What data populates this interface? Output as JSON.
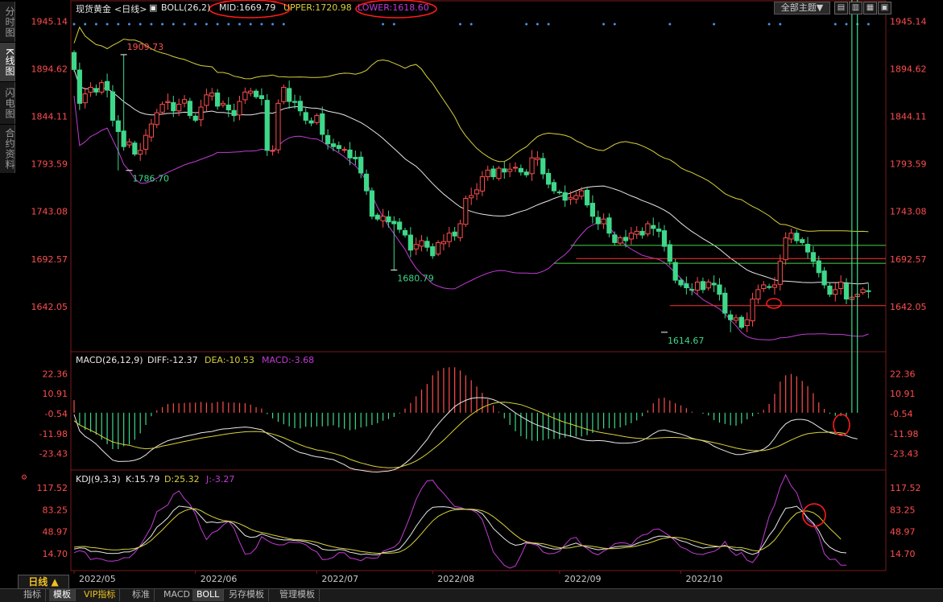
{
  "side_tabs": [
    "分时图",
    "K线图",
    "闪电图",
    "合约资料"
  ],
  "header": {
    "title": "现货黄金",
    "period": "<日线>",
    "boll": {
      "label": "BOLL(26,2)",
      "mid": "MID:1669.79",
      "upper": "UPPER:1720.98",
      "lower": "LOWER:1618.60"
    },
    "theme_select": "全部主题▼",
    "buttons": [
      "▤",
      "▥",
      "▦",
      "▣"
    ]
  },
  "macd_header": {
    "label": "MACD(26,12,9)",
    "diff": "DIFF:-12.37",
    "dea": "DEA:-10.53",
    "macd": "MACD:-3.68"
  },
  "kdj_header": {
    "label": "KDJ(9,3,3)",
    "k": "K:15.79",
    "d": "D:25.32",
    "j": "J:-3.27"
  },
  "bottom": {
    "period_btn": "日线 ▲",
    "tabs": [
      "指标",
      "模板",
      "VIP指标",
      "标准",
      "MACD",
      "BOLL",
      "另存模板",
      "管理模板"
    ]
  },
  "colors": {
    "up": "#ff4d4d",
    "down": "#3ed88a",
    "mid": "#e8e8e8",
    "upper": "#d8d13a",
    "lower": "#c23bd4",
    "j": "#c23bd4",
    "axis": "#ff4d4d",
    "date": "#c8c8c8"
  },
  "chart_data": {
    "type": "candlestick",
    "main": {
      "y_ticks": [
        1945.14,
        1894.62,
        1844.11,
        1793.59,
        1743.08,
        1692.57,
        1642.05
      ],
      "ylim": [
        1600,
        1955
      ],
      "annotations": [
        {
          "label": "1909.73",
          "x": "2022/05/13",
          "price": 1909.73
        },
        {
          "label": "1786.70",
          "x": "2022/05/16",
          "price": 1786.7
        },
        {
          "label": "1680.79",
          "x": "2022/07/21",
          "price": 1680.79
        },
        {
          "label": "1614.67",
          "x": "2022/09/28",
          "price": 1614.67
        }
      ],
      "hlines": [
        {
          "price": 1707,
          "color": "#46d246",
          "x_from": "2022/09/05",
          "x_to": "end"
        },
        {
          "price": 1693,
          "color": "#ff3030",
          "x_from": "2022/09/06",
          "x_to": "end"
        },
        {
          "price": 1688,
          "color": "#46d246",
          "x_from": "2022/08/31",
          "x_to": "end"
        },
        {
          "price": 1643,
          "color": "#ff3030",
          "x_from": "2022/09/29",
          "x_to": "end"
        }
      ],
      "closes": [
        1894,
        1858,
        1868,
        1875,
        1870,
        1880,
        1872,
        1840,
        1828,
        1812,
        1817,
        1804,
        1808,
        1824,
        1836,
        1848,
        1857,
        1860,
        1850,
        1857,
        1862,
        1845,
        1840,
        1854,
        1867,
        1869,
        1855,
        1858,
        1851,
        1845,
        1860,
        1870,
        1871,
        1865,
        1863,
        1808,
        1808,
        1858,
        1875,
        1860,
        1859,
        1850,
        1840,
        1837,
        1845,
        1825,
        1815,
        1812,
        1810,
        1809,
        1800,
        1799,
        1784,
        1765,
        1738,
        1735,
        1738,
        1732,
        1730,
        1724,
        1718,
        1702,
        1708,
        1712,
        1705,
        1696,
        1710,
        1711,
        1720,
        1717,
        1730,
        1757,
        1760,
        1766,
        1780,
        1787,
        1780,
        1789,
        1785,
        1788,
        1790,
        1785,
        1782,
        1800,
        1800,
        1783,
        1772,
        1765,
        1763,
        1755,
        1758,
        1760,
        1765,
        1750,
        1738,
        1730,
        1735,
        1720,
        1710,
        1715,
        1712,
        1720,
        1722,
        1718,
        1730,
        1725,
        1722,
        1706,
        1690,
        1670,
        1665,
        1662,
        1660,
        1668,
        1660,
        1668,
        1665,
        1655,
        1635,
        1628,
        1630,
        1620,
        1628,
        1650,
        1660,
        1665,
        1663,
        1665,
        1690,
        1715,
        1720,
        1712,
        1710,
        1700,
        1690,
        1678,
        1665,
        1655,
        1660,
        1668,
        1650,
        1652,
        1655,
        1660,
        1658
      ]
    },
    "macd": {
      "y_ticks": [
        22.36,
        10.91,
        -0.54,
        -11.98,
        -23.43
      ],
      "ylim": [
        -30,
        28
      ],
      "diff": [
        -1,
        -10.4,
        -13.5,
        -15.5,
        -17.9,
        -21.2,
        -24.2,
        -27.1,
        -27.9,
        -27.8,
        -27.7,
        -27.2,
        -26.1,
        -24.1,
        -21.4,
        -19.2,
        -17.5,
        -16,
        -15.1,
        -14.4,
        -13.6,
        -12.9,
        -12.3,
        -11.5,
        -11.1,
        -10.7,
        -9.9,
        -9.3,
        -9.1,
        -8.7,
        -8.4,
        -8.2,
        -8.5,
        -9.1,
        -9.7,
        -11.9,
        -13.8,
        -15.8,
        -17.6,
        -19.6,
        -21.4,
        -22.8,
        -23.5,
        -24.5,
        -25.2,
        -25.6,
        -26.3,
        -26.8,
        -28.3,
        -29.7,
        -31.6,
        -32.5,
        -32.9,
        -33.4,
        -33.8,
        -33.9,
        -33.6,
        -33.3,
        -32.6,
        -31.3,
        -29,
        -26.3,
        -22.9,
        -19.1,
        -15.3,
        -10.3,
        -6.5,
        -2.9,
        0.4,
        3.5,
        5.6,
        7.1,
        8.2,
        8.6,
        8.6,
        8.3,
        7.5,
        6.2,
        4.4,
        2.2,
        -0.1,
        -2.1,
        -4,
        -5.7,
        -7.1,
        -8.2,
        -9.3,
        -10.6,
        -11.9,
        -12.6,
        -13.4,
        -14.3,
        -15.3,
        -15.9,
        -16.1,
        -15.9,
        -16.1,
        -16.5,
        -17.1,
        -17.4,
        -17.4,
        -17.2,
        -16.8,
        -15.8,
        -14.2,
        -12,
        -10.3,
        -9.9,
        -10.6,
        -11.4,
        -12.2,
        -13.3,
        -14.6,
        -15.3,
        -16.1,
        -17.2,
        -19.2,
        -20.6,
        -21.8,
        -23,
        -23.9,
        -23.9,
        -23.2,
        -22.6,
        -22,
        -20.8,
        -18.5,
        -14.6,
        -9.8,
        -6.4,
        -4.5,
        -3.8,
        -3.8,
        -4.4,
        -6,
        -8.2,
        -10.1,
        -11.4,
        -12.1,
        -12.4,
        -13.1,
        -14.3,
        -15
      ],
      "dea": [
        -4.6,
        -7,
        -8.6,
        -10,
        -11.6,
        -13.5,
        -15.2,
        -16.7,
        -17.5,
        -18.2,
        -18.6,
        -19.5,
        -20.2,
        -20.6,
        -20.4,
        -19.9,
        -19.1,
        -18.5,
        -17.8,
        -17.1,
        -16.4,
        -15.8,
        -15.2,
        -14.6,
        -14,
        -13.5,
        -13,
        -12.5,
        -12,
        -11.6,
        -11.2,
        -10.9,
        -10.8,
        -10.7,
        -10.9,
        -11.5,
        -12.2,
        -13.2,
        -14.3,
        -15.7,
        -17,
        -18.3,
        -19.5,
        -20.4,
        -21.3,
        -21.7,
        -22.5,
        -23.2,
        -24.1,
        -25.1,
        -26.6,
        -27.7,
        -28.7,
        -29.5,
        -30.3,
        -30.9,
        -31.3,
        -31.5,
        -31.4,
        -31.1,
        -30.2,
        -29.1,
        -27.6,
        -25.7,
        -23.5,
        -21,
        -18.5,
        -15.7,
        -12.6,
        -9.5,
        -6.5,
        -3.6,
        -1.1,
        1.1,
        2.9,
        4.4,
        5.4,
        5.9,
        6,
        5.7,
        5.2,
        4.6,
        3.5,
        2.3,
        1,
        -0.3,
        -1.8,
        -3.1,
        -4.4,
        -5.5,
        -6.5,
        -7.5,
        -8.5,
        -9.5,
        -10.3,
        -11,
        -11.6,
        -12.1,
        -12.6,
        -13.2,
        -13.8,
        -14.2,
        -14.6,
        -14.8,
        -14.9,
        -14.7,
        -14.4,
        -14.2,
        -14.1,
        -14.1,
        -14.3,
        -14.6,
        -14.9,
        -15.3,
        -15.8,
        -16.4,
        -17.1,
        -17.8,
        -18.6,
        -19.4,
        -20.2,
        -20.8,
        -21.3,
        -21.6,
        -21.7,
        -21.6,
        -21,
        -20,
        -18.7,
        -17.1,
        -15.6,
        -14.2,
        -12.9,
        -12,
        -11.6,
        -11.2,
        -11.2,
        -11.1,
        -11.2,
        -11.5,
        -12
      ]
    },
    "kdj": {
      "y_ticks": [
        117.52,
        83.25,
        48.97,
        14.7
      ],
      "ylim": [
        -8,
        125
      ],
      "k": [
        21.9,
        23.6,
        23,
        18.1,
        18.3,
        17,
        15.2,
        14.8,
        15.2,
        17.2,
        17.3,
        20.7,
        25.9,
        33.6,
        42.5,
        55.9,
        62.8,
        70.6,
        81.8,
        88.8,
        87.6,
        86.7,
        82.1,
        72.4,
        63.2,
        64.1,
        62.9,
        64,
        65.3,
        60.8,
        51.7,
        42.8,
        40.1,
        40.9,
        45.5,
        42.4,
        39.4,
        37.3,
        36,
        36.2,
        35.1,
        34.7,
        33.2,
        30,
        27.4,
        21.6,
        20.2,
        19.8,
        21.1,
        20.3,
        16.9,
        15.4,
        13.3,
        14.3,
        13.2,
        12.8,
        16.3,
        17.4,
        18.8,
        22.3,
        31.9,
        43.4,
        57.3,
        69.2,
        80.2,
        86.8,
        87.7,
        87.8,
        86.8,
        84.8,
        84.7,
        83.8,
        83.7,
        81.6,
        76.9,
        66.3,
        54,
        46,
        37.9,
        31.4,
        27.8,
        29,
        32.4,
        31.1,
        29.7,
        25.9,
        23.5,
        21.9,
        22.1,
        25.5,
        28.6,
        31.2,
        27.5,
        24.9,
        22.6,
        20.7,
        21.7,
        22.7,
        25.1,
        26.1,
        26.5,
        26.7,
        30.4,
        33.7,
        35.7,
        39.7,
        42.1,
        41.8,
        40.6,
        38.2,
        34.6,
        32.5,
        28.6,
        25.6,
        23.3,
        24.6,
        25.1,
        25.6,
        27.5,
        23.3,
        20.1,
        20.8,
        16.2,
        13.4,
        16.5,
        28.8,
        42.9,
        54,
        71.1,
        85.5,
        86.6,
        88.6,
        80.8,
        70.4,
        62.5,
        50.4,
        33.8,
        24.9,
        19.7,
        16.6,
        15.8
      ],
      "d": [
        24.8,
        25.7,
        25.9,
        24.4,
        23.7,
        22.4,
        21.2,
        20.6,
        20.6,
        21.6,
        21.7,
        22.8,
        25.2,
        29.5,
        35.4,
        43.8,
        51.6,
        60.6,
        69.2,
        76.9,
        81.3,
        84.3,
        84.9,
        81.7,
        76.6,
        72.6,
        69.1,
        66.5,
        65.4,
        64.2,
        61.2,
        57.2,
        52.7,
        49.6,
        47.7,
        45.9,
        43.7,
        41.8,
        39.8,
        38,
        36.6,
        36.2,
        35.4,
        34.2,
        32.3,
        29.7,
        27.3,
        25.2,
        23.5,
        22.5,
        21.4,
        19.9,
        18.1,
        17.1,
        16,
        15.2,
        15.3,
        15.3,
        15.8,
        17.2,
        21.4,
        27.8,
        36.4,
        45.8,
        56.2,
        65.7,
        72.8,
        77.5,
        81.1,
        83.1,
        83.6,
        83.9,
        84.1,
        83.2,
        81.6,
        77.8,
        72.4,
        65.6,
        58.6,
        50.9,
        43.7,
        37.4,
        33.3,
        31.6,
        30.9,
        30.2,
        28.1,
        25.4,
        24,
        23.3,
        23.9,
        25.7,
        27.1,
        27,
        26,
        24.6,
        23.2,
        22.4,
        22.6,
        23.3,
        24.3,
        25.1,
        26.6,
        28.8,
        30.8,
        33.5,
        36.6,
        38.8,
        39.9,
        40.2,
        39.4,
        37.5,
        35,
        32.8,
        30.1,
        28.2,
        26.7,
        25.8,
        26.4,
        25.4,
        24.2,
        24,
        22.1,
        19.7,
        18.8,
        22.4,
        28,
        35.9,
        47.2,
        59.5,
        69.8,
        78,
        80.8,
        81.2,
        78.6,
        72.4,
        63.2,
        54,
        45.8,
        37.2
      ],
      "j": [
        16.2,
        19.3,
        17,
        5.4,
        7.5,
        6.1,
        3.3,
        2.9,
        4.3,
        8.3,
        8.4,
        16.4,
        27.2,
        41.9,
        56.5,
        80.2,
        85.2,
        90.6,
        107,
        112.6,
        100.3,
        91.5,
        76.5,
        53.8,
        36.4,
        47.2,
        50.5,
        59.1,
        65.1,
        54,
        32.6,
        13.9,
        15,
        23.5,
        41.1,
        35.4,
        30.7,
        28.4,
        28.4,
        32.6,
        32,
        31.7,
        28.7,
        21.5,
        17.5,
        5.4,
        5.9,
        9,
        16.3,
        16,
        7.9,
        6.4,
        3.6,
        8.8,
        7.6,
        8.1,
        18.4,
        21.7,
        24.8,
        32.5,
        53.1,
        74.5,
        99,
        116,
        128.1,
        129.1,
        117.5,
        108.6,
        98.1,
        88.1,
        86.9,
        83.6,
        82.9,
        78.6,
        67.5,
        43.3,
        17.2,
        6.7,
        -3.6,
        -7.9,
        -4.5,
        12.2,
        30.7,
        29.9,
        27.5,
        17.3,
        14.4,
        14.8,
        18.4,
        28.8,
        38,
        40,
        28.4,
        22.7,
        15.9,
        12.8,
        18.6,
        23,
        30.2,
        31.6,
        31.1,
        28,
        37.9,
        43.4,
        45.4,
        52.2,
        53.1,
        47.8,
        42,
        34.2,
        25,
        21.9,
        16.2,
        14,
        13.5,
        16.3,
        18.1,
        23.3,
        33.7,
        19.4,
        12,
        16.3,
        4.4,
        0.8,
        12.1,
        41.8,
        72.7,
        90.8,
        118.7,
        137.5,
        120.3,
        109.8,
        85.2,
        66.5,
        60.6,
        43.2,
        14.6,
        5.5,
        6,
        -3.3,
        -3.3
      ]
    },
    "x_labels": [
      "2022/05",
      "2022/06",
      "2022/07",
      "2022/08",
      "2022/09",
      "2022/10"
    ],
    "grid": false
  }
}
